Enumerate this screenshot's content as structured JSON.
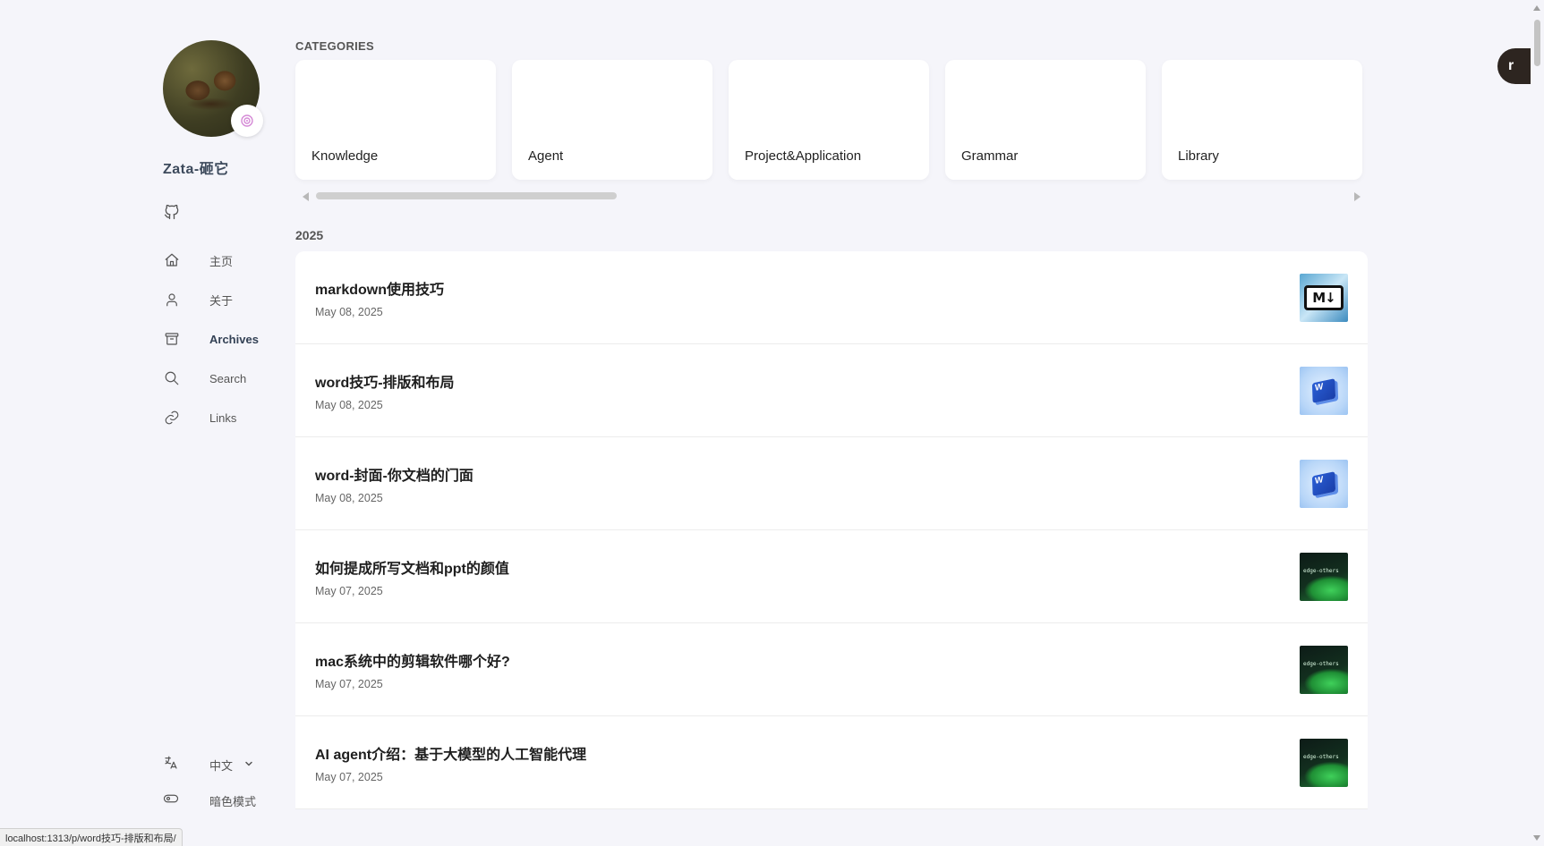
{
  "sidebar": {
    "site_name": "Zata-砸它",
    "menu": [
      {
        "label": "主页"
      },
      {
        "label": "关于"
      },
      {
        "label": "Archives"
      },
      {
        "label": "Search"
      },
      {
        "label": "Links"
      }
    ],
    "language_label": "中文",
    "dark_mode_label": "暗色模式"
  },
  "main": {
    "categories_title": "CATEGORIES",
    "categories": [
      {
        "name": "Knowledge"
      },
      {
        "name": "Agent"
      },
      {
        "name": "Project&Application"
      },
      {
        "name": "Grammar"
      },
      {
        "name": "Library"
      }
    ],
    "year": "2025",
    "articles": [
      {
        "title": "markdown使用技巧",
        "date": "May 08, 2025",
        "thumb": "markdown"
      },
      {
        "title": "word技巧-排版和布局",
        "date": "May 08, 2025",
        "thumb": "word"
      },
      {
        "title": "word-封面-你文档的门面",
        "date": "May 08, 2025",
        "thumb": "word"
      },
      {
        "title": "如何提成所写文档和ppt的颜值",
        "date": "May 07, 2025",
        "thumb": "green"
      },
      {
        "title": "mac系统中的剪辑软件哪个好?",
        "date": "May 07, 2025",
        "thumb": "green"
      },
      {
        "title": "AI agent介绍：基于大模型的人工智能代理",
        "date": "May 07, 2025",
        "thumb": "green"
      }
    ]
  },
  "thumb_text": {
    "markdown": "M↓",
    "word": "W",
    "green": "edge-others"
  },
  "status_bar_url": "localhost:1313/p/word技巧-排版和布局/",
  "float_button_label": "r",
  "colors": {
    "background": "#f5f5fa",
    "card": "#ffffff",
    "active_menu": "#334155"
  }
}
